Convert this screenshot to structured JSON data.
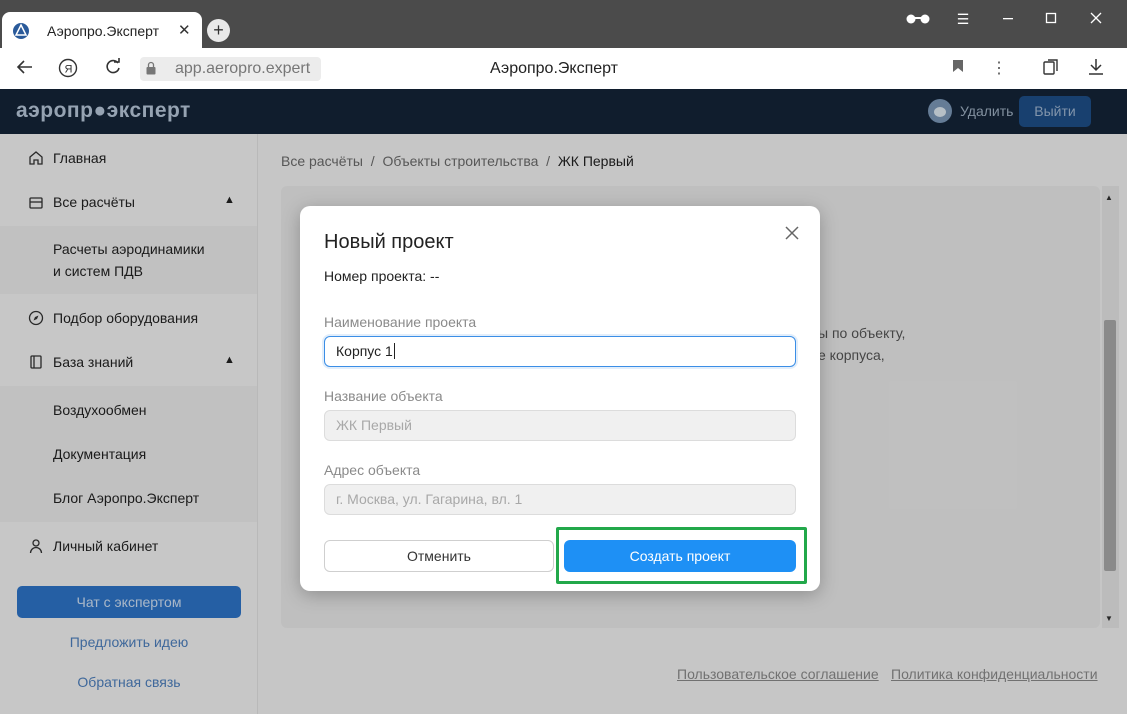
{
  "browser": {
    "tab_title": "Аэропро.Эксперт",
    "tab_close": "✕",
    "new_tab": "+",
    "url": "app.aeropro.expert",
    "page_title": "Аэропро.Эксперт"
  },
  "header": {
    "logo": "аэропр●эксперт",
    "delete_label": "Удалить",
    "exit_label": "Выйти"
  },
  "sidebar": {
    "items": [
      {
        "label": "Главная"
      },
      {
        "label": "Все расчёты"
      },
      {
        "label": "Подбор оборудования"
      },
      {
        "label": "База знаний"
      },
      {
        "label": "Личный кабинет"
      }
    ],
    "calc_sub": [
      "Расчеты аэродинамики",
      "и систем ПДВ"
    ],
    "knowledge_sub": [
      "Воздухообмен",
      "Документация",
      "Блог Аэропро.Эксперт"
    ],
    "chat_button": "Чат с экспертом",
    "suggest_link": "Предложить идею",
    "feedback_link": "Обратная связь"
  },
  "breadcrumbs": {
    "items": [
      "Все расчёты",
      "Объекты строительства",
      "ЖК Первый"
    ],
    "separator": "/"
  },
  "card": {
    "line1": "ы по объекту,",
    "line2": "е корпуса,"
  },
  "footer": {
    "agreement": "Пользовательское соглашение",
    "privacy": "Политика конфиденциальности"
  },
  "modal": {
    "title": "Новый проект",
    "project_number": "Номер проекта: --",
    "name_label": "Наименование проекта",
    "name_value": "Корпус 1",
    "object_label": "Название объекта",
    "object_placeholder": "ЖК Первый",
    "address_label": "Адрес объекта",
    "address_placeholder": "г. Москва, ул. Гагарина, вл. 1",
    "cancel_label": "Отменить",
    "create_label": "Создать проект"
  },
  "colors": {
    "header_bg": "#142438",
    "primary": "#1e90f5",
    "highlight": "#22a84a"
  }
}
